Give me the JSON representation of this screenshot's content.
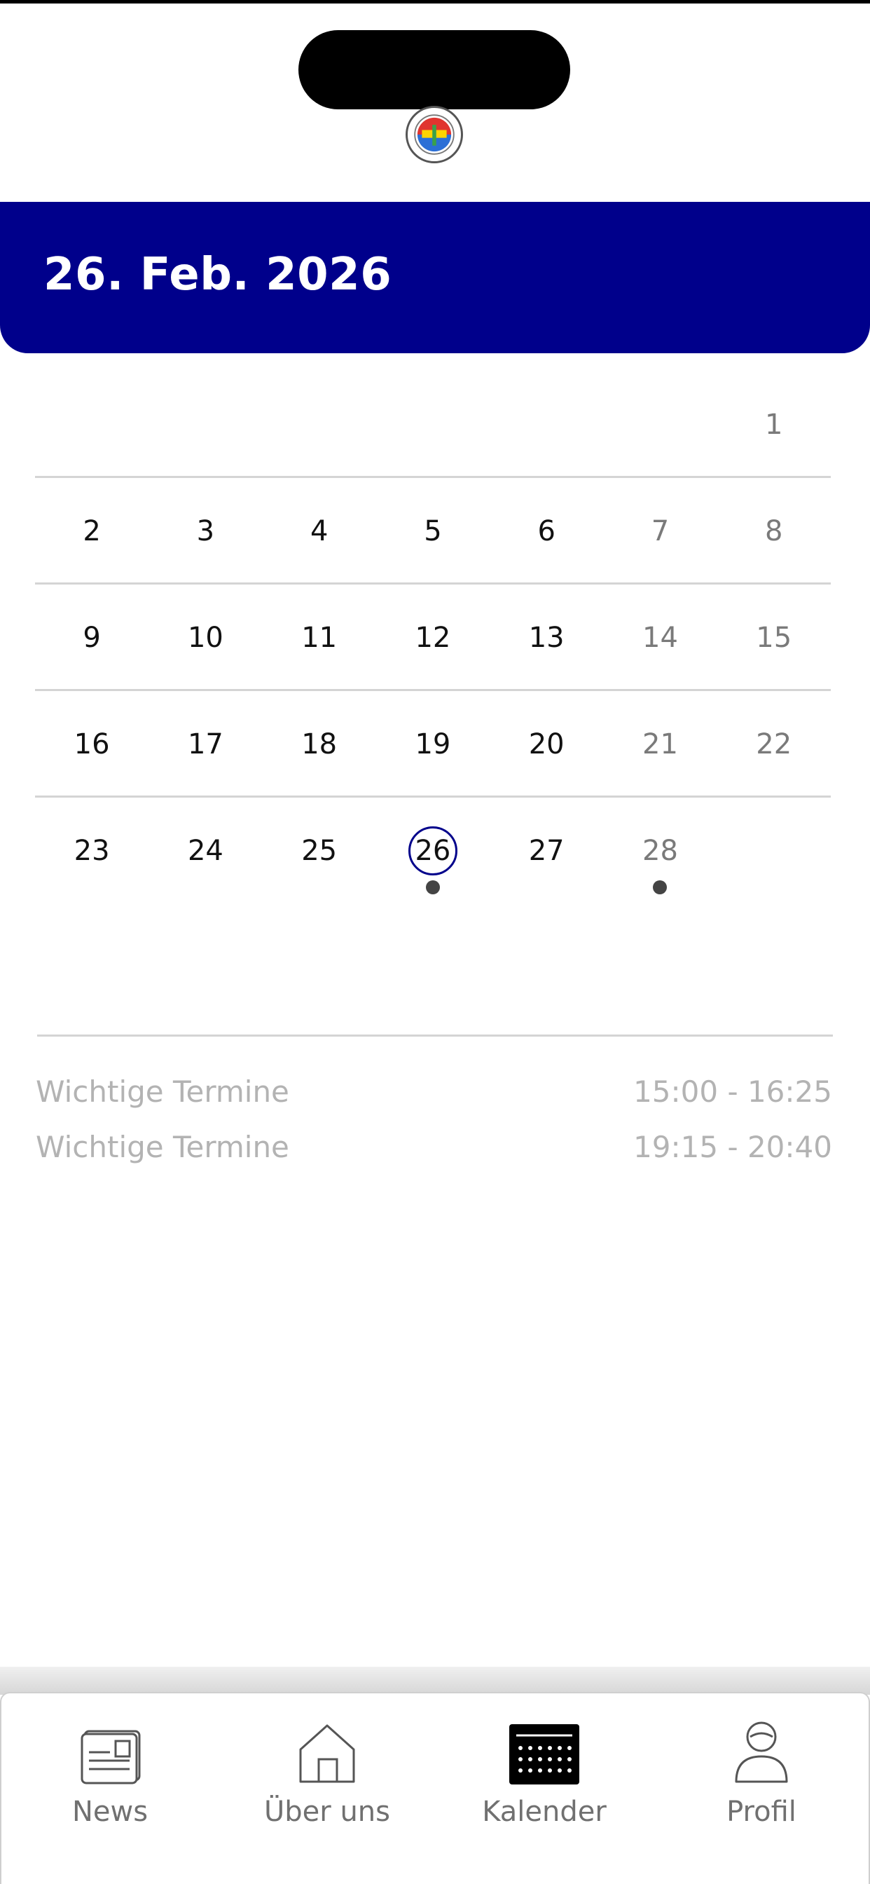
{
  "header": {
    "date_title": "26. Feb. 2026",
    "accent_color": "#00008b"
  },
  "calendar": {
    "weeks": [
      [
        {
          "label": "",
          "weekend": false,
          "selected": false,
          "dot": false
        },
        {
          "label": "",
          "weekend": false,
          "selected": false,
          "dot": false
        },
        {
          "label": "",
          "weekend": false,
          "selected": false,
          "dot": false
        },
        {
          "label": "",
          "weekend": false,
          "selected": false,
          "dot": false
        },
        {
          "label": "",
          "weekend": false,
          "selected": false,
          "dot": false
        },
        {
          "label": "",
          "weekend": true,
          "selected": false,
          "dot": false
        },
        {
          "label": "1",
          "weekend": true,
          "selected": false,
          "dot": false
        }
      ],
      [
        {
          "label": "2",
          "weekend": false,
          "selected": false,
          "dot": false
        },
        {
          "label": "3",
          "weekend": false,
          "selected": false,
          "dot": false
        },
        {
          "label": "4",
          "weekend": false,
          "selected": false,
          "dot": false
        },
        {
          "label": "5",
          "weekend": false,
          "selected": false,
          "dot": false
        },
        {
          "label": "6",
          "weekend": false,
          "selected": false,
          "dot": false
        },
        {
          "label": "7",
          "weekend": true,
          "selected": false,
          "dot": false
        },
        {
          "label": "8",
          "weekend": true,
          "selected": false,
          "dot": false
        }
      ],
      [
        {
          "label": "9",
          "weekend": false,
          "selected": false,
          "dot": false
        },
        {
          "label": "10",
          "weekend": false,
          "selected": false,
          "dot": false
        },
        {
          "label": "11",
          "weekend": false,
          "selected": false,
          "dot": false
        },
        {
          "label": "12",
          "weekend": false,
          "selected": false,
          "dot": false
        },
        {
          "label": "13",
          "weekend": false,
          "selected": false,
          "dot": false
        },
        {
          "label": "14",
          "weekend": true,
          "selected": false,
          "dot": false
        },
        {
          "label": "15",
          "weekend": true,
          "selected": false,
          "dot": false
        }
      ],
      [
        {
          "label": "16",
          "weekend": false,
          "selected": false,
          "dot": false
        },
        {
          "label": "17",
          "weekend": false,
          "selected": false,
          "dot": false
        },
        {
          "label": "18",
          "weekend": false,
          "selected": false,
          "dot": false
        },
        {
          "label": "19",
          "weekend": false,
          "selected": false,
          "dot": false
        },
        {
          "label": "20",
          "weekend": false,
          "selected": false,
          "dot": false
        },
        {
          "label": "21",
          "weekend": true,
          "selected": false,
          "dot": false
        },
        {
          "label": "22",
          "weekend": true,
          "selected": false,
          "dot": false
        }
      ],
      [
        {
          "label": "23",
          "weekend": false,
          "selected": false,
          "dot": false
        },
        {
          "label": "24",
          "weekend": false,
          "selected": false,
          "dot": false
        },
        {
          "label": "25",
          "weekend": false,
          "selected": false,
          "dot": false
        },
        {
          "label": "26",
          "weekend": false,
          "selected": true,
          "dot": true
        },
        {
          "label": "27",
          "weekend": false,
          "selected": false,
          "dot": false
        },
        {
          "label": "28",
          "weekend": true,
          "selected": false,
          "dot": true
        },
        {
          "label": "",
          "weekend": true,
          "selected": false,
          "dot": false
        }
      ]
    ]
  },
  "events": [
    {
      "title": "Wichtige Termine",
      "time": "15:00 - 16:25"
    },
    {
      "title": "Wichtige Termine",
      "time": "19:15 - 20:40"
    }
  ],
  "tabs": [
    {
      "label": "News",
      "icon": "newspaper-icon",
      "active": false
    },
    {
      "label": "Über uns",
      "icon": "home-icon",
      "active": false
    },
    {
      "label": "Kalender",
      "icon": "calendar-icon",
      "active": true
    },
    {
      "label": "Profil",
      "icon": "person-icon",
      "active": false
    }
  ]
}
